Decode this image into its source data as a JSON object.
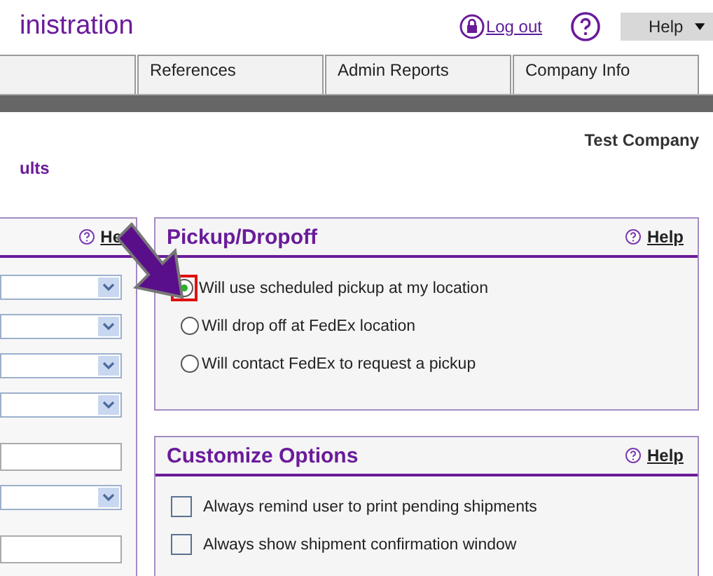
{
  "header": {
    "title": "inistration",
    "logout": "Log out",
    "help": "Help"
  },
  "tabs": [
    {
      "label": "References"
    },
    {
      "label": "Admin Reports"
    },
    {
      "label": "Company Info"
    }
  ],
  "company": "Test Company",
  "section_link": "ults",
  "left_panel": {
    "help": "He",
    "fields": [
      {
        "kind": "select"
      },
      {
        "kind": "select"
      },
      {
        "kind": "select"
      },
      {
        "kind": "select"
      },
      {
        "kind": "input"
      },
      {
        "kind": "select"
      },
      {
        "kind": "input"
      }
    ]
  },
  "pickup": {
    "title": "Pickup/Dropoff",
    "help": "Help",
    "options": [
      {
        "label": "Will use scheduled pickup at my location",
        "selected": true
      },
      {
        "label": "Will drop off at FedEx location",
        "selected": false
      },
      {
        "label": "Will contact FedEx to request a pickup",
        "selected": false
      }
    ]
  },
  "customize": {
    "title": "Customize Options",
    "help": "Help",
    "options": [
      {
        "label": "Always remind user to print pending shipments",
        "checked": false
      },
      {
        "label": "Always show shipment confirmation window",
        "checked": false
      }
    ]
  }
}
